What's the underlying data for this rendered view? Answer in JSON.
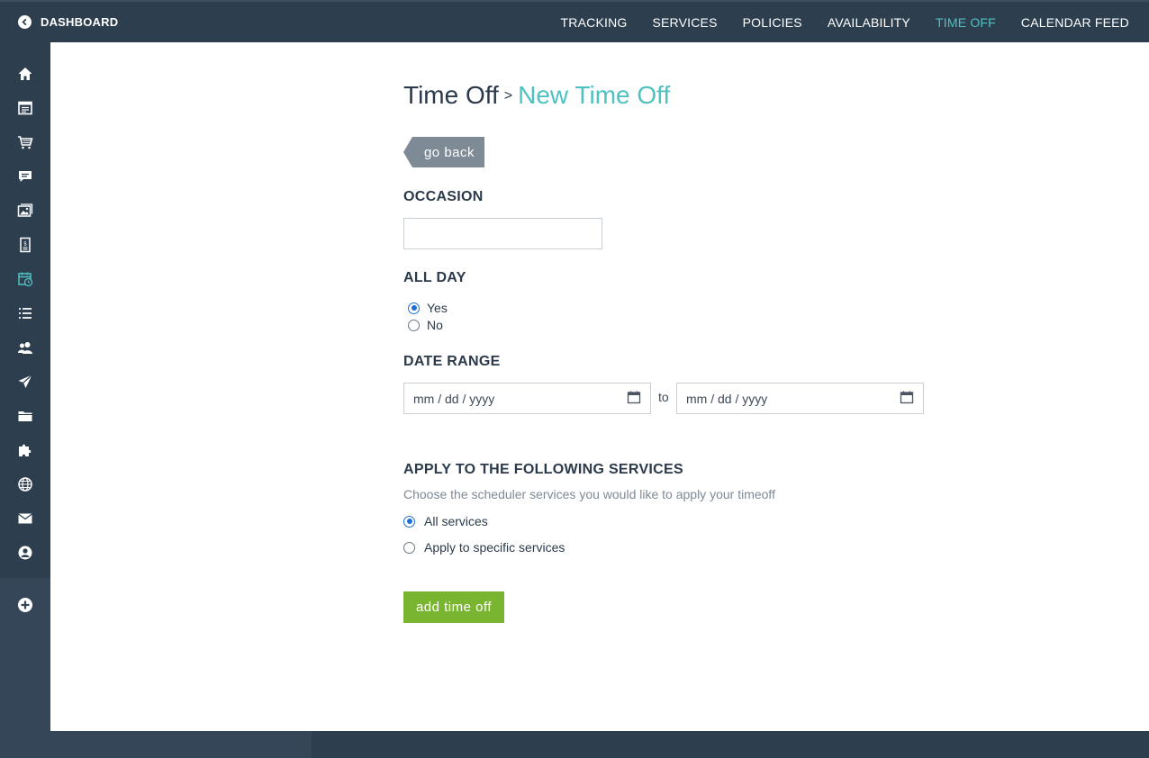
{
  "topbar": {
    "back_label": "DASHBOARD",
    "nav": [
      {
        "label": "TRACKING"
      },
      {
        "label": "SERVICES"
      },
      {
        "label": "POLICIES"
      },
      {
        "label": "AVAILABILITY"
      },
      {
        "label": "TIME OFF",
        "active": true
      },
      {
        "label": "CALENDAR FEED"
      }
    ]
  },
  "sidebar": {
    "icons": [
      "home-icon",
      "calendar-list-icon",
      "cart-icon",
      "comment-icon",
      "gallery-icon",
      "invoice-icon",
      "scheduler-icon",
      "list-icon",
      "users-icon",
      "send-icon",
      "folder-icon",
      "puzzle-icon",
      "globe-icon",
      "mail-icon",
      "user-circle-icon"
    ],
    "active_icon": "scheduler-icon",
    "add_icon": "plus-circle-icon"
  },
  "page": {
    "breadcrumb_parent": "Time Off",
    "breadcrumb_sep": ">",
    "breadcrumb_current": "New Time Off",
    "go_back_label": "go back"
  },
  "form": {
    "occasion_label": "OCCASION",
    "occasion_value": "",
    "all_day_label": "ALL DAY",
    "all_day_options": [
      "Yes",
      "No"
    ],
    "all_day_selected": "Yes",
    "date_range_label": "DATE RANGE",
    "date_from_placeholder": "mm / dd / yyyy",
    "date_to_placeholder": "mm / dd / yyyy",
    "date_to_label": "to",
    "services_label": "APPLY TO THE FOLLOWING SERVICES",
    "services_help": "Choose the scheduler services you would like to apply your timeoff",
    "services_options": [
      "All services",
      "Apply to specific services"
    ],
    "services_selected": "All services",
    "submit_label": "add time off"
  },
  "colors": {
    "nav_bg": "#2d3e4f",
    "accent": "#4ec2c2",
    "submit": "#79b530",
    "go_back_bg": "#7e8a96"
  }
}
